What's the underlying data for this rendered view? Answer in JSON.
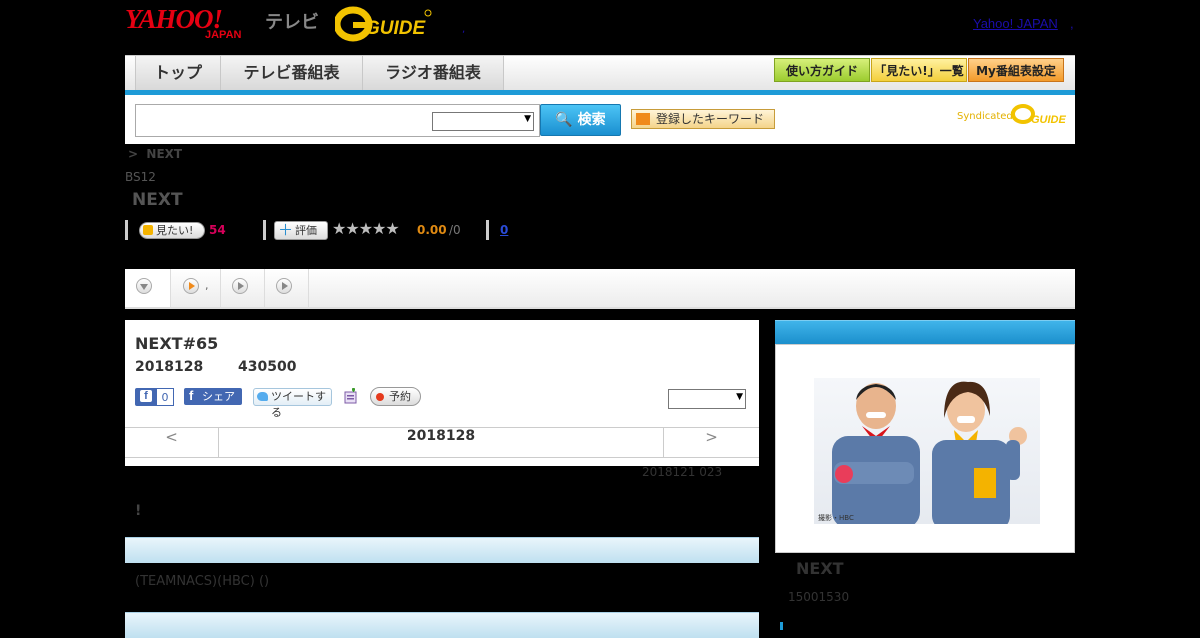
{
  "header": {
    "yahoo_logo": "YAHOO!",
    "japan_logo": "JAPAN",
    "tv_label": "テレビ",
    "gguide_logo": "G-GUIDE",
    "yahoo_japan_link": "Yahoo! JAPAN",
    "comma": ",",
    "dot": ","
  },
  "nav": {
    "tabs": [
      "トップ",
      "テレビ番組表",
      "ラジオ番組表"
    ],
    "buttons": [
      "使い方ガイド",
      "「見たい!」一覧",
      "My番組表設定"
    ],
    "colors": {
      "accent_blue": "#1e9bd7",
      "button_green": "#a6d23d",
      "button_yellow": "#f6d65b",
      "button_orange": "#f4a33a"
    }
  },
  "search": {
    "button_label": "検索",
    "keyword_button": "登録したキーワード",
    "syndicated": "Syndicated"
  },
  "program": {
    "breadcrumb_arrow": ">",
    "breadcrumb_title": "NEXT",
    "channel": "BS12",
    "title": "NEXT",
    "mitai_label": "見たい!",
    "mitai_count": "54",
    "hyouka_label": "評価",
    "stars": "★★★★★",
    "rating": "0.00",
    "rating_total": "/0",
    "review_count": "0"
  },
  "tabs": {
    "tab2_suffix": ","
  },
  "episode": {
    "title": "NEXT#65",
    "date": "2018128",
    "time": "430500",
    "fb_like_count": "0",
    "fb_share": "シェア",
    "tweet": "ツイートする",
    "yoyaku": "予約",
    "prev": "<",
    "current": "2018128",
    "next": ">",
    "updated": "2018121  023",
    "exclaim": "!",
    "cast": "(TEAMNACS)(HBC) ()"
  },
  "side": {
    "photo_credit": "撮影・HBC",
    "title": "NEXT",
    "time": "15001530"
  }
}
